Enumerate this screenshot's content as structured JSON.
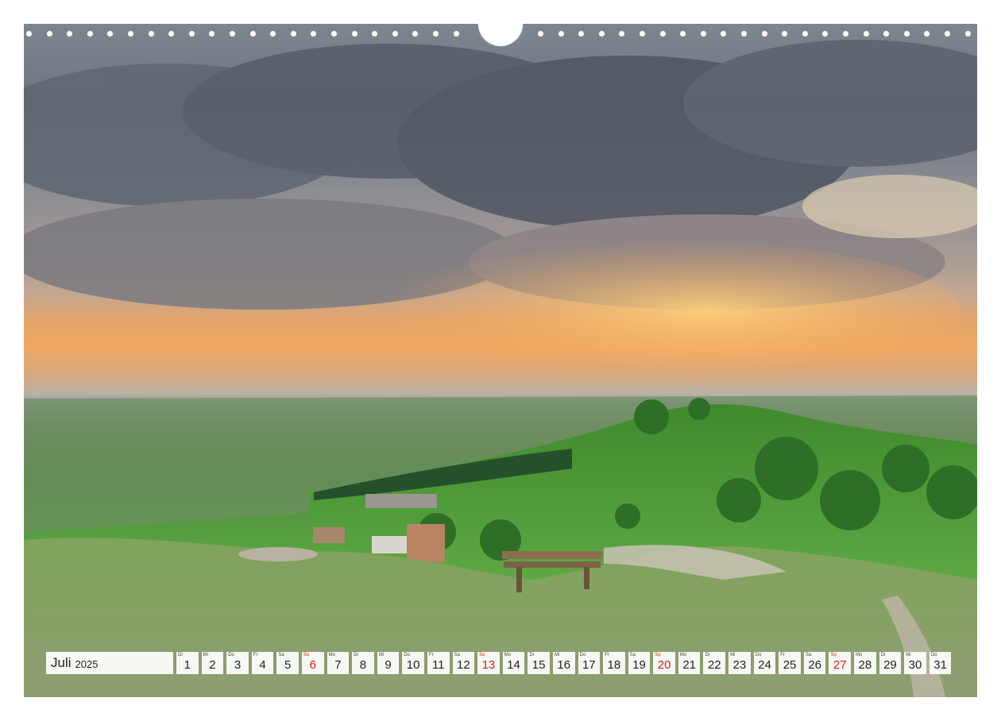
{
  "calendar": {
    "month": "Juli",
    "year": "2025",
    "days": [
      {
        "wd": "Di",
        "d": "1"
      },
      {
        "wd": "Mi",
        "d": "2"
      },
      {
        "wd": "Do",
        "d": "3"
      },
      {
        "wd": "Fr",
        "d": "4"
      },
      {
        "wd": "Sa",
        "d": "5"
      },
      {
        "wd": "So",
        "d": "6",
        "sunday": true
      },
      {
        "wd": "Mo",
        "d": "7"
      },
      {
        "wd": "Di",
        "d": "8"
      },
      {
        "wd": "Mi",
        "d": "9"
      },
      {
        "wd": "Do",
        "d": "10"
      },
      {
        "wd": "Fr",
        "d": "11"
      },
      {
        "wd": "Sa",
        "d": "12"
      },
      {
        "wd": "So",
        "d": "13",
        "sunday": true
      },
      {
        "wd": "Mo",
        "d": "14"
      },
      {
        "wd": "Di",
        "d": "15"
      },
      {
        "wd": "Mi",
        "d": "16"
      },
      {
        "wd": "Do",
        "d": "17"
      },
      {
        "wd": "Fr",
        "d": "18"
      },
      {
        "wd": "Sa",
        "d": "19"
      },
      {
        "wd": "So",
        "d": "20",
        "sunday": true
      },
      {
        "wd": "Mo",
        "d": "21"
      },
      {
        "wd": "Di",
        "d": "22"
      },
      {
        "wd": "Mi",
        "d": "23"
      },
      {
        "wd": "Do",
        "d": "24"
      },
      {
        "wd": "Fr",
        "d": "25"
      },
      {
        "wd": "Sa",
        "d": "26"
      },
      {
        "wd": "So",
        "d": "27",
        "sunday": true
      },
      {
        "wd": "Mo",
        "d": "28"
      },
      {
        "wd": "Di",
        "d": "29"
      },
      {
        "wd": "Mi",
        "d": "30"
      },
      {
        "wd": "Do",
        "d": "31"
      }
    ]
  },
  "colors": {
    "sunday": "#d11f1f",
    "text": "#222222"
  }
}
